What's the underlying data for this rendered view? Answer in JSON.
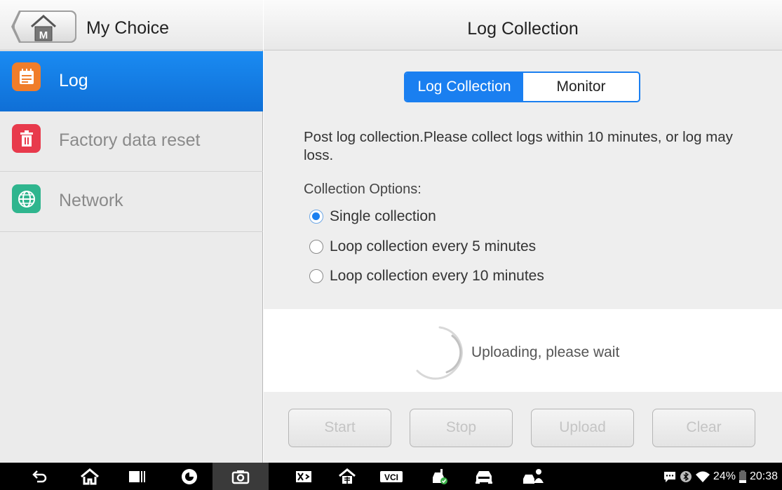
{
  "left_panel": {
    "title": "My Choice",
    "items": [
      {
        "label": "Log",
        "icon": "log-icon",
        "color": "#f07d2a",
        "active": true
      },
      {
        "label": "Factory data reset",
        "icon": "trash-icon",
        "color": "#e83a4c",
        "active": false
      },
      {
        "label": "Network",
        "icon": "globe-icon",
        "color": "#2fb58e",
        "active": false
      }
    ]
  },
  "right_panel": {
    "title": "Log Collection",
    "tabs": [
      {
        "label": "Log Collection",
        "selected": true
      },
      {
        "label": "Monitor",
        "selected": false
      }
    ],
    "description": "Post log collection.Please collect logs within 10 minutes, or log may loss.",
    "options_label": "Collection Options:",
    "options": [
      {
        "label": "Single collection",
        "selected": true
      },
      {
        "label": "Loop collection every 5 minutes",
        "selected": false
      },
      {
        "label": "Loop collection every 10 minutes",
        "selected": false
      }
    ],
    "upload_status": "Uploading, please wait",
    "buttons": {
      "start": "Start",
      "stop": "Stop",
      "upload": "Upload",
      "clear": "Clear"
    }
  },
  "status_bar": {
    "battery": "24%",
    "time": "20:38",
    "vci_label": "VCI"
  },
  "colors": {
    "accent": "#1a7ff0",
    "active_item": "#1583ec"
  }
}
